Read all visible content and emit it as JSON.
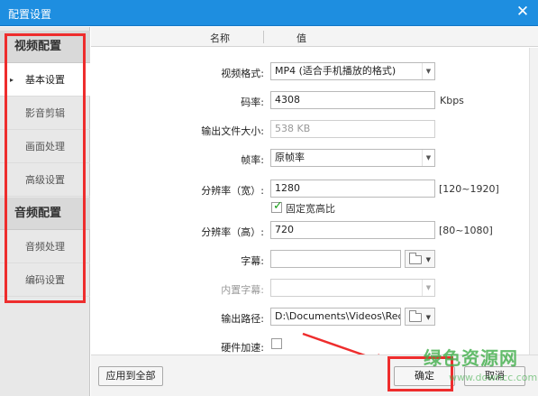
{
  "window": {
    "title": "配置设置",
    "close_glyph": "✕"
  },
  "sidebar": {
    "video_group": "视频配置",
    "audio_group": "音频配置",
    "video_items": [
      {
        "label": "基本设置",
        "active": true
      },
      {
        "label": "影音剪辑"
      },
      {
        "label": "画面处理"
      },
      {
        "label": "高级设置"
      }
    ],
    "audio_items": [
      {
        "label": "音频处理"
      },
      {
        "label": "编码设置"
      }
    ],
    "active_marker": "▸"
  },
  "table_header": {
    "name_col": "名称",
    "value_col": "值"
  },
  "settings": {
    "video_format": {
      "label": "视频格式:",
      "value": "MP4 (适合手机播放的格式)"
    },
    "bitrate": {
      "label": "码率:",
      "value": "4308",
      "unit": "Kbps"
    },
    "output_size": {
      "label": "输出文件大小:",
      "value": "538 KB"
    },
    "frame_rate": {
      "label": "帧率:",
      "value": "原帧率"
    },
    "res_width": {
      "label": "分辨率（宽）:",
      "value": "1280",
      "range": "[120~1920]"
    },
    "fixed_ratio": {
      "label": "固定宽高比",
      "checked": true
    },
    "res_height": {
      "label": "分辨率（高）:",
      "value": "720",
      "range": "[80~1080]"
    },
    "subtitle": {
      "label": "字幕:",
      "value": ""
    },
    "embedded_subtitle": {
      "label": "内置字幕:",
      "value": ""
    },
    "output_path": {
      "label": "输出路径:",
      "value": "D:\\Documents\\Videos\\Recc"
    },
    "hw_accel": {
      "label": "硬件加速:",
      "checked": false
    }
  },
  "footer": {
    "apply_all": "应用到全部",
    "ok": "确定",
    "cancel": "取消"
  },
  "watermark": {
    "line1": "绿色资源网",
    "line2": "www.downcc.com"
  },
  "colors": {
    "titlebar": "#1e8ee0",
    "annotation_red": "#ee2d2d",
    "watermark_green": "#3fae49"
  },
  "icons": {
    "dropdown": "triangle-down-icon",
    "folder": "folder-icon"
  }
}
